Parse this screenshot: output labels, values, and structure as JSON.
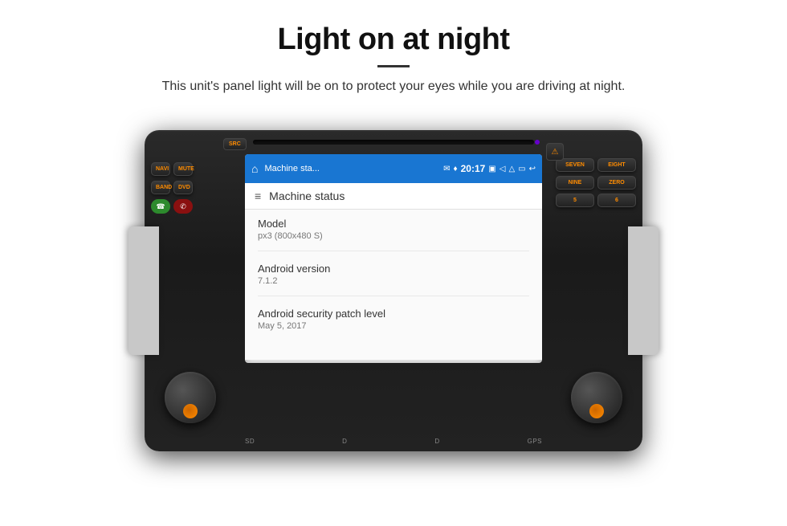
{
  "header": {
    "title": "Light on at night",
    "divider": true,
    "description": "This unit's panel light will be on to protect your eyes while you are driving at night."
  },
  "device": {
    "disc_slot": true,
    "indicator_color": "#6600cc",
    "buttons": {
      "left": [
        {
          "label": "SRC",
          "type": "top"
        },
        {
          "label": "NAVI",
          "type": "full"
        },
        {
          "label": "MUTE",
          "type": "full"
        },
        {
          "label": "BAND",
          "type": "full"
        },
        {
          "label": "DVD",
          "type": "full"
        }
      ],
      "right": [
        {
          "label": "SEVEN",
          "sub": "1"
        },
        {
          "label": "EIGHT",
          "sub": "2"
        },
        {
          "label": "NINE",
          "sub": "3"
        },
        {
          "label": "ZERO",
          "sub": "4"
        },
        {
          "label": "5",
          "sub": "5"
        },
        {
          "label": "6",
          "sub": "6"
        }
      ]
    },
    "bottom_labels": {
      "left": "SD",
      "left2": "D",
      "right": "D",
      "right2": "GPS"
    }
  },
  "screen": {
    "status_bar": {
      "home_icon": "⌂",
      "app_name": "Machine sta...",
      "message_icon": "✉",
      "pin_icon": "♦",
      "time": "20:17",
      "media_icon": "▣",
      "volume_icon": "◁",
      "upload_icon": "△",
      "screen_icon": "▭",
      "back_icon": "↩",
      "back_arrow": "↩"
    },
    "app_header": {
      "menu_icon": "≡",
      "title": "Machine status"
    },
    "items": [
      {
        "label": "Model",
        "value": "px3 (800x480 S)"
      },
      {
        "label": "Android version",
        "value": "7.1.2"
      },
      {
        "label": "Android security patch level",
        "value": "May 5, 2017"
      }
    ]
  },
  "icons": {
    "home": "⌂",
    "menu": "≡",
    "phone_green": "📞",
    "phone_red": "📵",
    "warning": "⚠"
  }
}
